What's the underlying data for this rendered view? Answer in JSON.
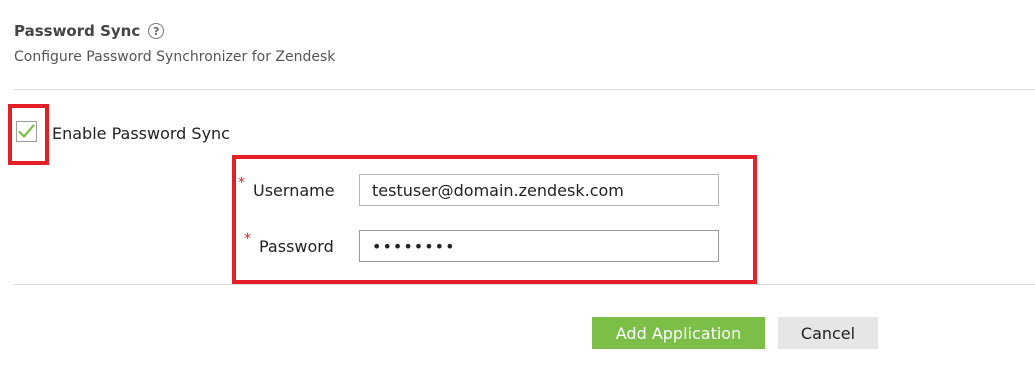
{
  "section": {
    "title": "Password Sync",
    "help_icon_glyph": "?",
    "subtitle": "Configure Password Synchronizer for Zendesk"
  },
  "enable_sync": {
    "label": "Enable Password Sync",
    "checked": true
  },
  "form": {
    "required_marker": "*",
    "username": {
      "label": "Username",
      "value": "testuser@domain.zendesk.com"
    },
    "password": {
      "label": "Password",
      "value": "••••••••"
    }
  },
  "actions": {
    "add_label": "Add Application",
    "cancel_label": "Cancel"
  },
  "colors": {
    "primary_button": "#7bbf48",
    "highlight": "#e3202a",
    "checkmark": "#7bbf48"
  },
  "icons": {
    "help": "question-circle-icon",
    "check": "checkmark-icon"
  }
}
